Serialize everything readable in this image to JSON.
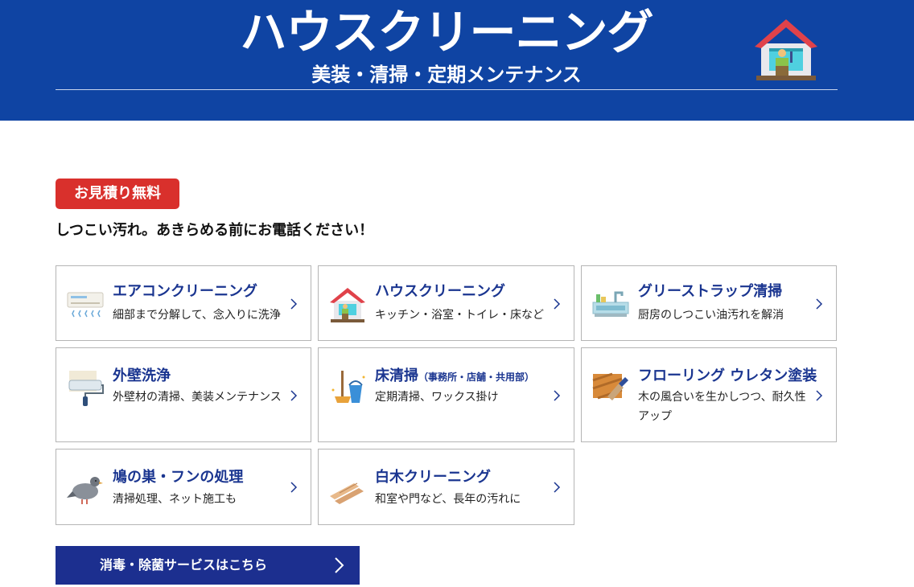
{
  "header": {
    "title": "ハウスクリーニング",
    "subtitle": "美装・清掃・定期メンテナンス",
    "house_icon": "house-cleaning-icon"
  },
  "badge": {
    "label": "お見積り無料",
    "color": "#d9302c"
  },
  "tagline": "しつこい汚れ。あきらめる前にお電話ください！",
  "colors": {
    "header_bg": "#0f44a3",
    "title_text": "#1a3590",
    "button_bg": "#1c2f8f"
  },
  "services": [
    {
      "title": "エアコンクリーニング",
      "note": "",
      "description": "細部まで分解して、念入りに洗浄",
      "icon": "air-conditioner-icon"
    },
    {
      "title": "ハウスクリーニング",
      "note": "",
      "description": "キッチン・浴室・トイレ・床など",
      "icon": "house-icon"
    },
    {
      "title": "グリーストラップ清掃",
      "note": "",
      "description": "厨房のしつこい油汚れを解消",
      "icon": "kitchen-sink-icon"
    },
    {
      "title": "外壁洗浄",
      "note": "",
      "description": "外壁材の清掃、美装メンテナンス",
      "icon": "paint-roller-icon"
    },
    {
      "title": "床清掃",
      "note": "（事務所・店舗・共用部）",
      "description": "定期清掃、ワックス掛け",
      "icon": "mop-bucket-icon"
    },
    {
      "title": "フローリング ウレタン塗装",
      "note": "",
      "description": "木の風合いを生かしつつ、耐久性アップ",
      "icon": "floor-brush-icon"
    },
    {
      "title": "鳩の巣・フンの処理",
      "note": "",
      "description": "清掃処理、ネット施工も",
      "icon": "pigeon-icon"
    },
    {
      "title": "白木クリーニング",
      "note": "",
      "description": "和室や門など、長年の汚れに",
      "icon": "wood-planks-icon"
    }
  ],
  "cta": {
    "label": "消毒・除菌サービスはこちら",
    "icon": "chevron-right-icon"
  }
}
